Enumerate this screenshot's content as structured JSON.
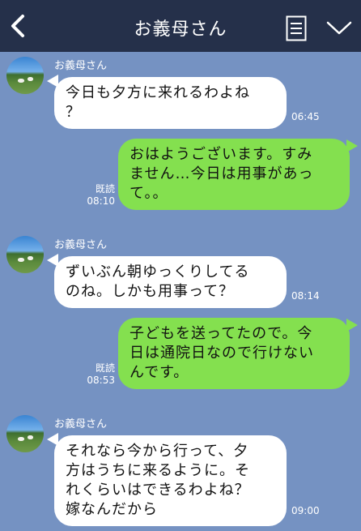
{
  "header": {
    "title": "お義母さん",
    "back_icon": "chevron-left-icon",
    "menu_icon": "list-icon",
    "expand_icon": "chevron-down-icon",
    "background": "#25304a"
  },
  "chat": {
    "background": "#7592c2",
    "incoming_bubble_color": "#ffffff",
    "outgoing_bubble_color": "#84e04f",
    "messages": [
      {
        "direction": "in",
        "sender": "お義母さん",
        "lines": [
          "今日も夕方に来れるわよね",
          "？"
        ],
        "time": "06:45"
      },
      {
        "direction": "out",
        "lines": [
          "おはようございます。すみ",
          "ません…今日は用事があっ",
          "て。。"
        ],
        "read": "既読",
        "time": "08:10"
      },
      {
        "direction": "in",
        "sender": "お義母さん",
        "lines": [
          "ずいぶん朝ゆっくりしてる",
          "のね。しかも用事って？"
        ],
        "time": "08:14"
      },
      {
        "direction": "out",
        "lines": [
          "子どもを送ってたので。今",
          "日は通院日なので行けない",
          "んです。"
        ],
        "read": "既読",
        "time": "08:53"
      },
      {
        "direction": "in",
        "sender": "お義母さん",
        "lines": [
          "それなら今から行って、夕",
          "方はうちに来るように。そ",
          "れくらいはできるわよね？",
          "嫁なんだから"
        ],
        "time": "09:00"
      }
    ]
  }
}
